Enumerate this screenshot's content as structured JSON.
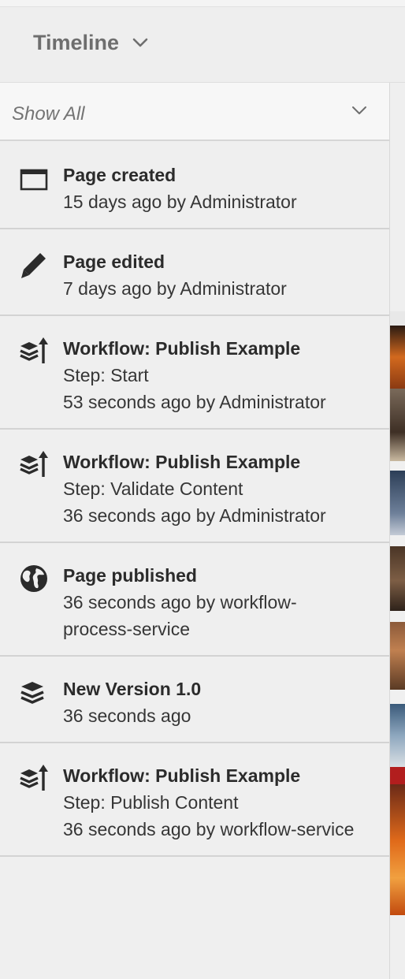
{
  "header": {
    "title": "Timeline",
    "dropdown_icon": "chevron-down-icon"
  },
  "filter": {
    "selected": "Show All",
    "dropdown_icon": "chevron-down-icon"
  },
  "timeline": {
    "items": [
      {
        "icon": "page-icon",
        "title": "Page created",
        "lines": [
          "15 days ago by Administrator"
        ]
      },
      {
        "icon": "pencil-icon",
        "title": "Page edited",
        "lines": [
          "7 days ago by Administrator"
        ]
      },
      {
        "icon": "workflow-icon",
        "title": "Workflow: Publish Example",
        "lines": [
          "Step: Start",
          "53 seconds ago by Administrator"
        ]
      },
      {
        "icon": "workflow-icon",
        "title": "Workflow: Publish Example",
        "lines": [
          "Step: Validate Content",
          "36 seconds ago by Administrator"
        ]
      },
      {
        "icon": "globe-icon",
        "title": "Page published",
        "lines": [
          "36 seconds ago by workflow-",
          "process-service"
        ]
      },
      {
        "icon": "layers-icon",
        "title": "New Version 1.0",
        "lines": [
          "36 seconds ago"
        ]
      },
      {
        "icon": "workflow-icon",
        "title": "Workflow: Publish Example",
        "lines": [
          "Step: Publish Content",
          "36 seconds ago by workflow-service"
        ]
      }
    ]
  },
  "colors": {
    "background": "#efefef",
    "text": "#323232",
    "divider": "#d3d3d3"
  }
}
